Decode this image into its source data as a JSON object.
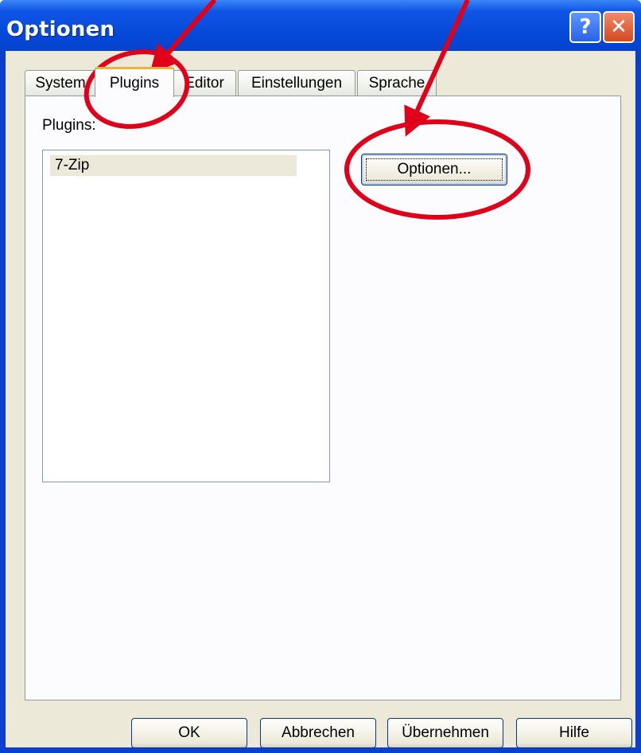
{
  "window": {
    "title": "Optionen",
    "help_glyph": "?",
    "close_glyph": "✕"
  },
  "tabs": [
    {
      "label": "System",
      "active": false
    },
    {
      "label": "Plugins",
      "active": true
    },
    {
      "label": "Editor",
      "active": false
    },
    {
      "label": "Einstellungen",
      "active": false
    },
    {
      "label": "Sprache",
      "active": false
    }
  ],
  "plugins_panel": {
    "label": "Plugins:",
    "list_items": [
      "7-Zip"
    ],
    "options_button": "Optionen..."
  },
  "footer": {
    "ok": "OK",
    "cancel": "Abbrechen",
    "apply": "Übernehmen",
    "help": "Hilfe"
  },
  "colors": {
    "annotation": "#e0001a",
    "titlebar": "#0447d6",
    "tab_highlight": "#f2b239"
  }
}
